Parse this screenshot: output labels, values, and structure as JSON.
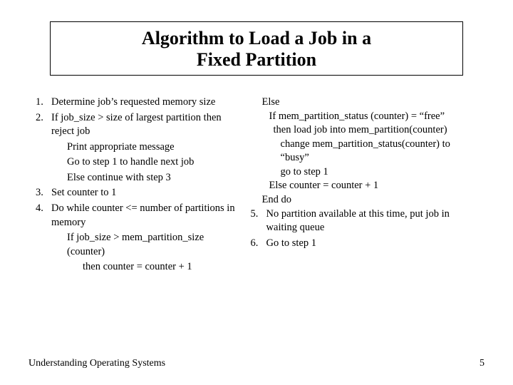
{
  "title": {
    "line1": "Algorithm to Load a Job in a",
    "line2": "Fixed Partition"
  },
  "left": {
    "s1_num": "1.",
    "s1": "Determine job’s requested memory size",
    "s2_num": "2.",
    "s2": "If job_size > size of largest partition then reject job",
    "s2a": "Print appropriate message",
    "s2b": "Go to step 1 to handle next job",
    "s2c": "Else continue with step 3",
    "s3_num": "3.",
    "s3": "Set counter to 1",
    "s4_num": "4.",
    "s4": "Do while counter <= number of partitions in memory",
    "s4a": "If job_size > mem_partition_size (counter)",
    "s4b": "then counter = counter + 1"
  },
  "right": {
    "r1": "Else",
    "r2": "If mem_partition_status (counter) = “free”",
    "r3": "then load job into mem_partition(counter)",
    "r4": "change mem_partition_status(counter) to “busy”",
    "r5": "go to step 1",
    "r6": "Else counter = counter + 1",
    "r7": "End do",
    "s5_num": "5.",
    "s5": "No partition available at this time, put job in waiting queue",
    "s6_num": "6.",
    "s6": "Go to step 1"
  },
  "footer": {
    "left": "Understanding Operating Systems",
    "right": "5"
  }
}
